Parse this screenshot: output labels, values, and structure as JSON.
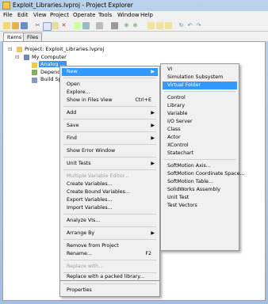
{
  "window": {
    "title": "Exploit_Libraries.lvproj - Project Explorer"
  },
  "menubar": [
    "File",
    "Edit",
    "View",
    "Project",
    "Operate",
    "Tools",
    "Window",
    "Help"
  ],
  "tabs": [
    "Items",
    "Files"
  ],
  "tree": {
    "project": "Project: Exploit_Libraries.lvproj",
    "computer": "My Computer",
    "item_selected": "Analog ...",
    "item_dependencies": "Depende",
    "item_build": "Build Spe"
  },
  "context_menu": {
    "new": "New",
    "open": "Open",
    "explore": "Explore...",
    "show_in_files": "Show in Files View",
    "show_in_files_shortcut": "Ctrl+E",
    "add": "Add",
    "save": "Save",
    "find": "Find",
    "show_error": "Show Error Window",
    "unit_tests": "Unit Tests",
    "multi_var": "Multiple Variable Editor...",
    "create_vars": "Create Variables...",
    "create_bound": "Create Bound Variables...",
    "export_vars": "Export Variables...",
    "import_vars": "Import Variables...",
    "analyze": "Analyze VIs...",
    "arrange": "Arrange By",
    "remove": "Remove from Project",
    "rename": "Rename...",
    "rename_shortcut": "F2",
    "replace_with": "Replace with...",
    "replace_packed": "Replace with a packed library...",
    "properties": "Properties"
  },
  "submenu": {
    "vi": "VI",
    "sim": "Simulation Subsystem",
    "virtual_folder": "Virtual Folder",
    "control": "Control",
    "library": "Library",
    "variable": "Variable",
    "io_server": "I/O Server",
    "class": "Class",
    "actor": "Actor",
    "xcontrol": "XControl",
    "statechart": "Statechart",
    "sm_axis": "SoftMotion Axis...",
    "sm_coord": "SoftMotion Coordinate Space...",
    "sm_table": "SoftMotion Table...",
    "solidworks": "SolidWorks Assembly",
    "unit_test": "Unit Test",
    "test_vectors": "Test Vectors"
  }
}
